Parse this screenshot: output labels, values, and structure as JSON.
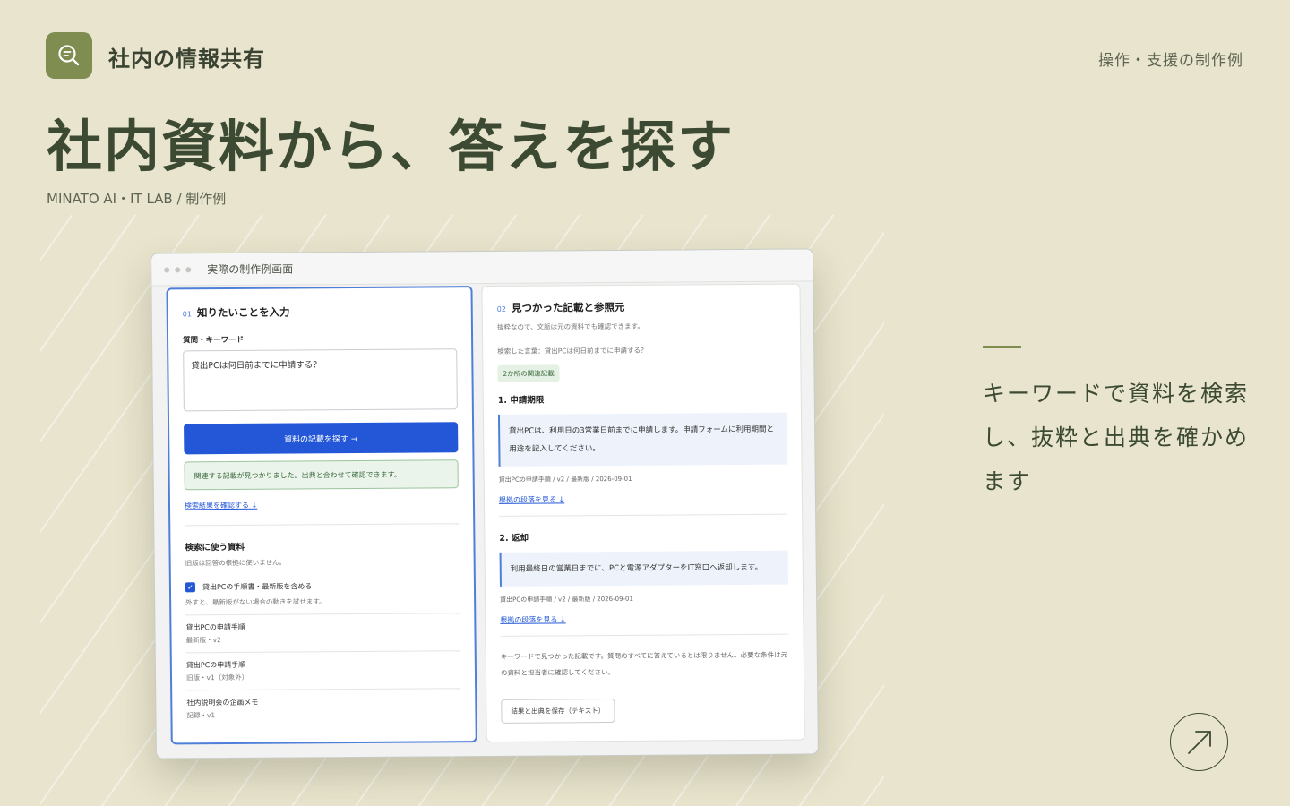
{
  "header": {
    "brand": "社内の情報共有",
    "top_right": "操作・支援の制作例",
    "headline": "社内資料から、答えを探す",
    "credit": "MINATO AI・IT LAB / 制作例"
  },
  "side": {
    "text": "キーワードで資料を検索し、抜粋と出典を確かめます"
  },
  "window": {
    "title": "実際の制作例画面",
    "left": {
      "num": "01",
      "title": "知りたいことを入力",
      "field_label": "質問・キーワード",
      "field_value": "貸出PCは何日前までに申請する？",
      "search_button": "資料の記載を探す →",
      "success_msg": "関連する記載が見つかりました。出典と合わせて確認できます。",
      "results_link": "検索結果を確認する ↓",
      "sources_title": "検索に使う資料",
      "sources_note": "旧版は回答の根拠に使いません。",
      "checkbox_label": "貸出PCの手順書・最新版を含める",
      "checkbox_note": "外すと、最新版がない場合の動きを試せます。",
      "docs": [
        {
          "name": "貸出PCの申請手順",
          "meta": "最新版・v2"
        },
        {
          "name": "貸出PCの申請手順",
          "meta": "旧版・v1（対象外）"
        },
        {
          "name": "社内説明会の企画メモ",
          "meta": "記録・v1"
        }
      ]
    },
    "right": {
      "num": "02",
      "title": "見つかった記載と参照元",
      "desc": "抜粋なので、文脈は元の資料でも確認できます。",
      "query": "検索した言葉：貸出PCは何日前までに申請する？",
      "tag": "2か所の関連記載",
      "results": [
        {
          "title": "1. 申請期限",
          "quote": "貸出PCは、利用日の3営業日前までに申請します。申請フォームに利用期間と用途を記入してください。",
          "meta": "貸出PCの申請手順 / v2 / 最新版 / 2026-09-01",
          "link": "根拠の段落を見る ↓"
        },
        {
          "title": "2. 返却",
          "quote": "利用最終日の営業日までに、PCと電源アダプターをIT窓口へ返却します。",
          "meta": "貸出PCの申請手順 / v2 / 最新版 / 2026-09-01",
          "link": "根拠の段落を見る ↓"
        }
      ],
      "note": "キーワードで見つかった記載です。質問のすべてに答えているとは限りません。必要な条件は元の資料と担当者に確認してください。",
      "save_button": "結果と出典を保存（テキスト）"
    }
  },
  "icons": {
    "logo": "search-document-icon",
    "arrow": "arrow-up-right-icon"
  },
  "colors": {
    "background": "#e8e4cd",
    "accent": "#7f8e50",
    "primary": "#2357d8"
  }
}
